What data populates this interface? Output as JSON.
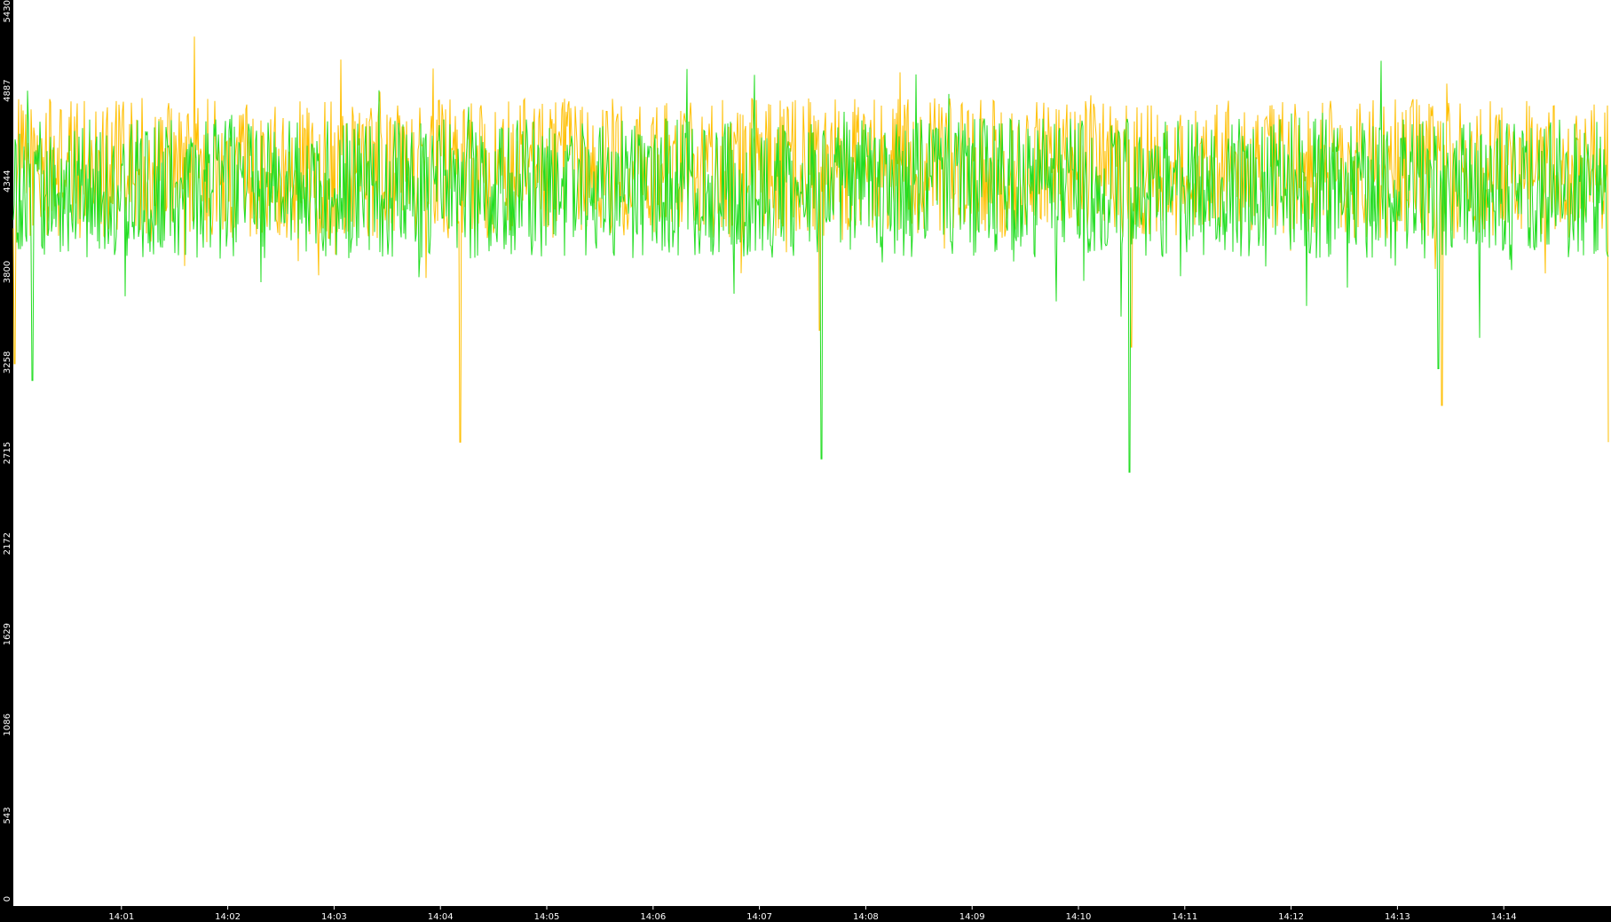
{
  "chart_data": {
    "type": "line",
    "title": "",
    "xlabel": "",
    "ylabel": "",
    "ylim": [
      0,
      5430
    ],
    "xlim": [
      "13:59:59",
      "14:14:59"
    ],
    "yticks": [
      0,
      543,
      1086,
      1629,
      2172,
      2715,
      3258,
      3800,
      4344,
      4887,
      5430
    ],
    "xticks": [
      "14:01",
      "14:02",
      "14:03",
      "14:04",
      "14:05",
      "14:06",
      "14:07",
      "14:08",
      "14:09",
      "14:10",
      "14:11",
      "14:12",
      "14:13",
      "14:14"
    ],
    "grid": false,
    "legend": "none",
    "series": [
      {
        "color": "#ffbf00",
        "mean": 4420,
        "amplitude": 420,
        "min": 2780,
        "max": 5430,
        "dips": [
          {
            "time": "14:00:00",
            "value": 3250
          },
          {
            "time": "14:04:11",
            "value": 2780
          },
          {
            "time": "14:07:34",
            "value": 3450
          },
          {
            "time": "14:10:30",
            "value": 3350
          },
          {
            "time": "14:13:25",
            "value": 3000
          },
          {
            "time": "14:14:59",
            "value": 2240
          }
        ]
      },
      {
        "color": "#22dd22",
        "mean": 4300,
        "amplitude": 420,
        "min": 2600,
        "max": 5250,
        "dips": [
          {
            "time": "14:00:10",
            "value": 3150
          },
          {
            "time": "14:07:35",
            "value": 2680
          },
          {
            "time": "14:10:29",
            "value": 2600
          },
          {
            "time": "14:13:23",
            "value": 3220
          }
        ]
      }
    ]
  }
}
